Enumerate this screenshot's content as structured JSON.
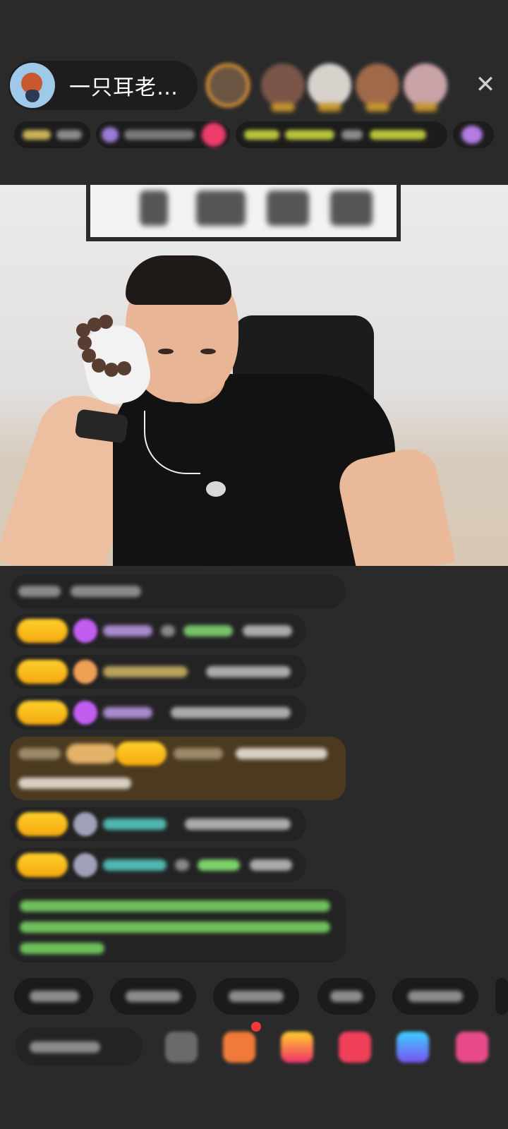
{
  "header": {
    "host_name": "一只耳老…",
    "close_icon": "close-icon"
  },
  "viewers": {
    "count_visible": 5
  },
  "colors": {
    "background": "#2a2a2b",
    "level_badge": "#ffc21f",
    "announce_bg": "#4b3a20",
    "green_text": "#7bd36a"
  },
  "icons": [
    "close-icon",
    "gift-icon",
    "treasure-icon",
    "heart-icon",
    "game-icon",
    "more-icon"
  ]
}
